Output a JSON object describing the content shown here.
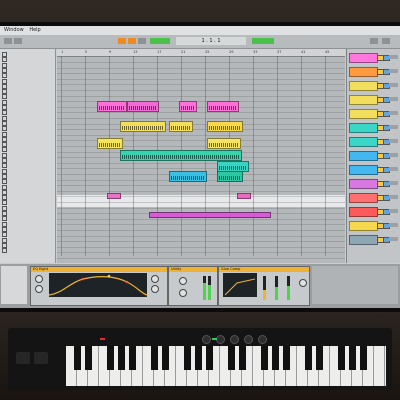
{
  "menubar": {
    "items": [
      "Window",
      "Help"
    ]
  },
  "transport": {
    "position": "1 . 1 . 1"
  },
  "browser": {
    "items": [
      "",
      "",
      "",
      "",
      "",
      "",
      "",
      "",
      "",
      "",
      "",
      "",
      "",
      "",
      "",
      "",
      "",
      "",
      "",
      "",
      "",
      "",
      "",
      "",
      "",
      "",
      "",
      "",
      "",
      "",
      "",
      "",
      "",
      "",
      "",
      "",
      "",
      ""
    ]
  },
  "arrangement": {
    "ruler": [
      "1",
      "5",
      "9",
      "13",
      "17",
      "21",
      "25",
      "29",
      "33",
      "37",
      "41",
      "45"
    ],
    "clips": [
      {
        "label": "",
        "color": "#ff6fd8"
      },
      {
        "label": "",
        "color": "#f06bd3"
      },
      {
        "label": "",
        "color": "#ff72da"
      },
      {
        "label": "",
        "color": "#ff70d6"
      },
      {
        "label": "",
        "color": "#f2de5c"
      },
      {
        "label": "",
        "color": "#f2de5c"
      },
      {
        "label": "",
        "color": "#f6d84f"
      },
      {
        "label": "",
        "color": "#f4e35d"
      },
      {
        "label": "",
        "color": "#f5e463"
      },
      {
        "label": "",
        "color": "#35d3b0"
      },
      {
        "label": "",
        "color": "#3ad2c0"
      },
      {
        "label": "",
        "color": "#3bbfe0"
      },
      {
        "label": "",
        "color": "#2fc6a4"
      },
      {
        "label": "",
        "color": "#e971c8"
      },
      {
        "label": "",
        "color": "#e86cc4"
      },
      {
        "label": "",
        "color": "#d65cd6"
      }
    ]
  },
  "mixer": {
    "tracks": [
      {
        "label": "",
        "color": "#ff77dc"
      },
      {
        "label": "",
        "color": "#ff9a40"
      },
      {
        "label": "",
        "color": "#f2de5c"
      },
      {
        "label": "",
        "color": "#f2de5c"
      },
      {
        "label": "",
        "color": "#f2de5c"
      },
      {
        "label": "",
        "color": "#3bd6c8"
      },
      {
        "label": "",
        "color": "#3bd6c8"
      },
      {
        "label": "",
        "color": "#43b8f0"
      },
      {
        "label": "",
        "color": "#43b8f0"
      },
      {
        "label": "",
        "color": "#d978e0"
      },
      {
        "label": "",
        "color": "#ff6f6f"
      },
      {
        "label": "",
        "color": "#ff5a5a"
      },
      {
        "label": "",
        "color": "#f6d84f"
      },
      {
        "label": "",
        "color": "#8fa6b5"
      }
    ]
  },
  "devices": {
    "eq": {
      "title": "EQ Eight"
    },
    "utility": {
      "title": "Utility"
    },
    "comp": {
      "title": "Glue Comp"
    }
  },
  "info": {
    "text": ""
  },
  "hint": {
    "text": ""
  },
  "colors": {
    "accent": "#f08a1c",
    "device_header": "#f0b233"
  }
}
